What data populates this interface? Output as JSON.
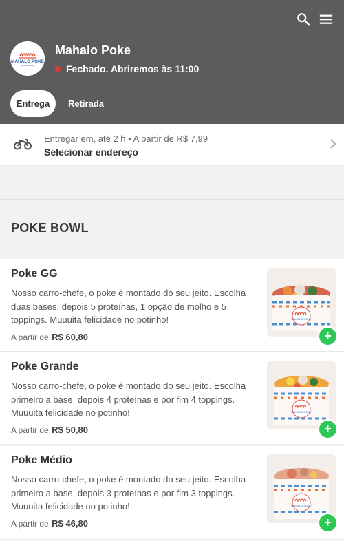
{
  "header": {
    "store_name": "Mahalo Poke",
    "status_text": "Fechado. Abriremos às 11:00",
    "logo_text": "MAHALO POKE",
    "status_color": "#e53935",
    "icons": [
      "search-icon",
      "menu-icon"
    ]
  },
  "tabs": [
    {
      "label": "Entrega",
      "active": true
    },
    {
      "label": "Retirada",
      "active": false
    }
  ],
  "delivery": {
    "line1": "Entregar em, até 2 h • A partir de R$ 7,99",
    "line2": "Selecionar endereço",
    "icon": "motorcycle-icon"
  },
  "section": {
    "title": "POKE BOWL"
  },
  "items": [
    {
      "name": "Poke GG",
      "description": "Nosso carro-chefe, o poke é montado do seu jeito. Escolha duas bases, depois 5 proteínas, 1 opção de molho e 5 toppings. Muuuita felicidade no potinho!",
      "price_prefix": "A partir de",
      "price": "R$ 60,80",
      "add_label": "+"
    },
    {
      "name": "Poke Grande",
      "description": "Nosso carro-chefe, o poke é montado do seu jeito. Escolha primeiro a base, depois 4 proteínas e por fim 4 toppings. Muuuita felicidade no potinho!",
      "price_prefix": "A partir de",
      "price": "R$ 50,80",
      "add_label": "+"
    },
    {
      "name": "Poke Médio",
      "description": "Nosso carro-chefe, o poke é montado do seu jeito. Escolha primeiro a base, depois 3 proteínas e por fim 3 toppings. Muuuita felicidade no potinho!",
      "price_prefix": "A partir de",
      "price": "R$ 46,80",
      "add_label": "+"
    }
  ],
  "colors": {
    "header_bg": "#5c5c5c",
    "add_button": "#2ec857",
    "page_bg": "#f2f2f2"
  }
}
